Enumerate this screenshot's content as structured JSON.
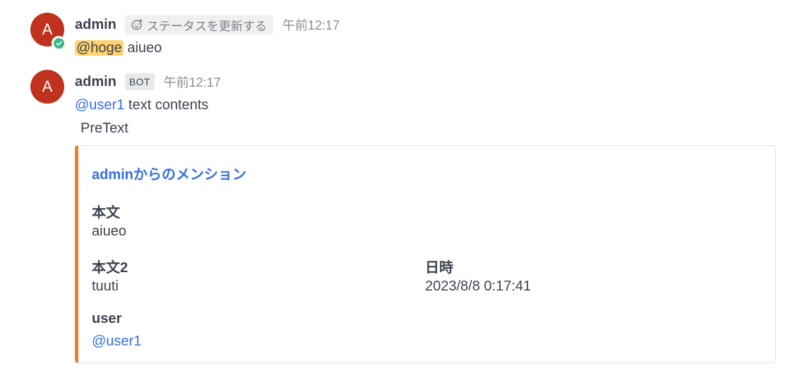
{
  "post1": {
    "avatar_letter": "A",
    "username": "admin",
    "status_button_label": "ステータスを更新する",
    "time": "午前12:17",
    "mention": "@hoge",
    "text": " aiueo"
  },
  "post2": {
    "avatar_letter": "A",
    "username": "admin",
    "bot_badge": "BOT",
    "time": "午前12:17",
    "mention": "@user1",
    "text": " text contents",
    "pretext": "PreText"
  },
  "attachment": {
    "color": "#e8832b",
    "title": "adminからのメンション",
    "fields": [
      {
        "label": "本文",
        "value": "aiueo"
      },
      {
        "label": "本文2",
        "value": "tuuti"
      },
      {
        "label": "日時",
        "value": "2023/8/8 0:17:41"
      },
      {
        "label": "user",
        "value": "@user1"
      }
    ]
  },
  "colors": {
    "avatar": "#c0311e",
    "online": "#3db887",
    "mention_highlight": "#ffd470",
    "link": "#386fe5"
  }
}
